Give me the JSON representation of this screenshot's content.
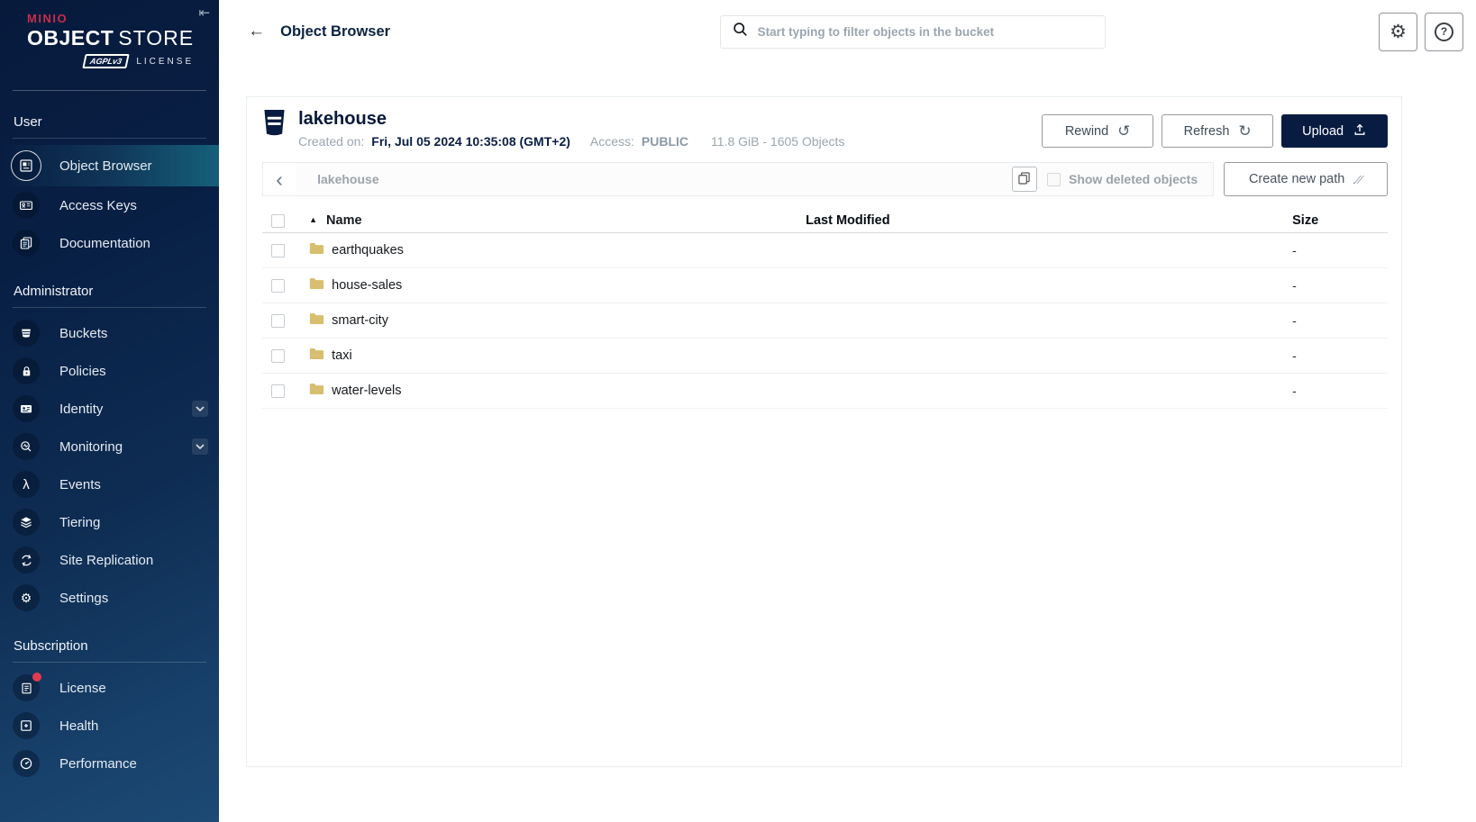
{
  "colors": {
    "brand_red": "#C72C48",
    "navy": "#081C42",
    "folder": "#D8BE70",
    "active_teal": "#15607B"
  },
  "brand": {
    "name": "MINIO",
    "product_bold": "OBJECT",
    "product_light": "STORE",
    "badge": "AGPLv3",
    "license": "LICENSE"
  },
  "sidebar": {
    "sections": [
      {
        "label": "User",
        "items": [
          {
            "label": "Object Browser"
          },
          {
            "label": "Access Keys"
          },
          {
            "label": "Documentation"
          }
        ]
      },
      {
        "label": "Administrator",
        "items": [
          {
            "label": "Buckets"
          },
          {
            "label": "Policies"
          },
          {
            "label": "Identity"
          },
          {
            "label": "Monitoring"
          },
          {
            "label": "Events"
          },
          {
            "label": "Tiering"
          },
          {
            "label": "Site Replication"
          },
          {
            "label": "Settings"
          }
        ]
      },
      {
        "label": "Subscription",
        "items": [
          {
            "label": "License"
          },
          {
            "label": "Health"
          },
          {
            "label": "Performance"
          }
        ]
      }
    ]
  },
  "topbar": {
    "title": "Object Browser",
    "search_placeholder": "Start typing to filter objects in the bucket"
  },
  "bucket": {
    "name": "lakehouse",
    "created_label": "Created on:",
    "created_value": "Fri, Jul 05 2024 10:35:08 (GMT+2)",
    "access_label": "Access:",
    "access_value": "PUBLIC",
    "usage": "11.8 GiB - 1605 Objects",
    "rewind_label": "Rewind",
    "refresh_label": "Refresh",
    "upload_label": "Upload"
  },
  "pathbar": {
    "current_path": "lakehouse",
    "show_deleted_label": "Show deleted objects",
    "create_path_label": "Create new path"
  },
  "table": {
    "headers": {
      "name": "Name",
      "last_modified": "Last Modified",
      "size": "Size"
    },
    "rows": [
      {
        "name": "earthquakes",
        "size": "-"
      },
      {
        "name": "house-sales",
        "size": "-"
      },
      {
        "name": "smart-city",
        "size": "-"
      },
      {
        "name": "taxi",
        "size": "-"
      },
      {
        "name": "water-levels",
        "size": "-"
      }
    ]
  },
  "icons": {
    "back_arrow": "←",
    "collapse": "⇤",
    "gear": "⚙",
    "help": "?",
    "chevron_left": "‹",
    "rewind": "↺",
    "refresh": "↻",
    "sort_asc": "▲",
    "lambda": "λ",
    "create_path": ".∕∕"
  }
}
